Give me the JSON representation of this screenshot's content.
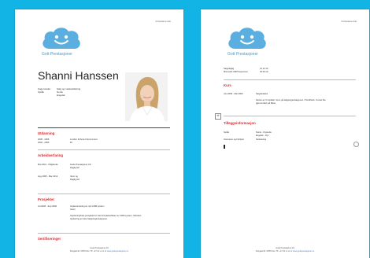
{
  "brand": {
    "name": "Gott Prestasjoner",
    "cloud_color": "#5aaee0"
  },
  "corner_label": "Kompetanse side",
  "page1": {
    "name": "Shanni Hanssen",
    "info": [
      {
        "label": "Fagomrader",
        "value": "Salg og markedsføring"
      },
      {
        "label": "Språk",
        "value": "Norsk"
      },
      {
        "label": "",
        "value": "Engelsk"
      }
    ],
    "sections": {
      "utdanning": "Utdanning",
      "arbeidserfaring": "Arbeidserfaring",
      "prosjekter": "Prosjekter",
      "sertifiseringer": "Sertifiseringer"
    },
    "education": [
      {
        "period": "2005 - 2006",
        "title": "London School of Economics"
      },
      {
        "period": "2002 - 2005",
        "title": "BI"
      }
    ],
    "work": [
      {
        "period": "Mai 2012 - Pågående",
        "company": "Gode Prestasjoner AS",
        "role": "Daglig leif"
      },
      {
        "period": "Aug 2005 - Mar 2012",
        "company": "Venn og",
        "role": "Daglig leif"
      }
    ],
    "project": {
      "period": "Jul 2006 - Sep 2006",
      "name": "Implementering av nytt CRM system",
      "org": "Intern",
      "desc1": "Opplæring/hele prosjektet for det komplette/flaten av CRM system. Inkludert",
      "desc2": "opplæring av hele Salgsorganisasjonen."
    }
  },
  "page2": {
    "certs": [
      {
        "name": "Salgsfaglig",
        "date": "01.12.10"
      },
      {
        "name": "Microsoft CRM Superuser",
        "date": "30.06.10"
      }
    ],
    "section_kurs": "Kurs",
    "course": {
      "period": "Jan 2009 - Mai 2009",
      "name": "Salgsledelse",
      "desc1": "Første av 3 moduler i kurs på salgsorganisasjonen i Trondheim. Kurset ble",
      "desc2": "gjennomført på Møre"
    },
    "section_tillegg": "Tilleggsinformasjon",
    "extra": [
      {
        "label": "Språk",
        "value": "Norsk - Flytende"
      },
      {
        "label": "",
        "value": "Engelsk - Flyt"
      },
      {
        "label": "Interesser og hobbyer",
        "value": "Seilsetning"
      }
    ]
  },
  "footer": {
    "company": "Gode Prestasjoner AS",
    "address": "Storgata 9b, 0155 Oslo, Tlf: +47 22 xx xx xx",
    "link": "www.godeprestasjoner.no"
  }
}
